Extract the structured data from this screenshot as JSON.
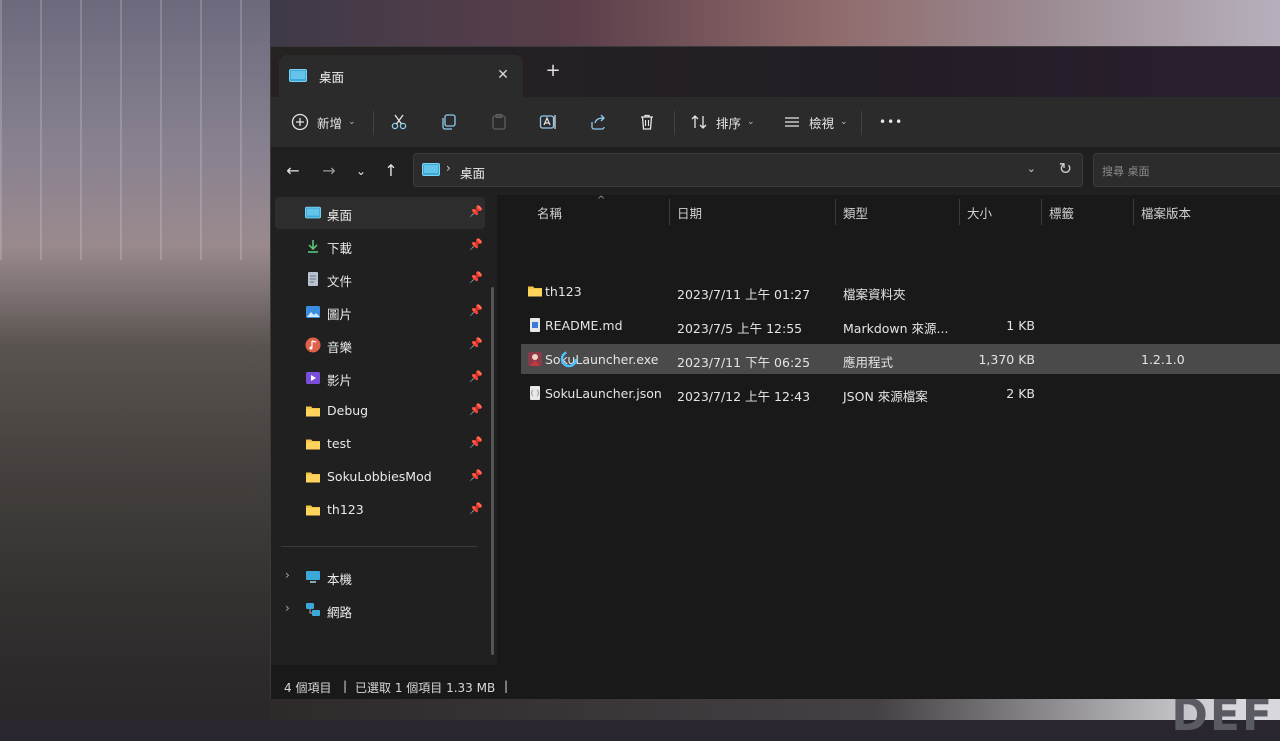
{
  "window": {
    "tab_title": "桌面",
    "tab_close": "✕",
    "new_tab": "+"
  },
  "toolbar": {
    "new_label": "新增",
    "sort_label": "排序",
    "view_label": "檢視",
    "more": "•••",
    "icons": [
      "plus-circle-icon",
      "scissors-icon",
      "copy-icon",
      "paste-icon",
      "rename-icon",
      "share-icon",
      "trash-icon",
      "sort-icon",
      "view-icon",
      "more-icon"
    ]
  },
  "nav": {
    "breadcrumb": "桌面",
    "search_placeholder": "搜尋 桌面"
  },
  "sidebar": {
    "items": [
      {
        "label": "桌面",
        "icon": "desktop-icon",
        "pinned": true
      },
      {
        "label": "下載",
        "icon": "download-icon",
        "pinned": true
      },
      {
        "label": "文件",
        "icon": "document-icon",
        "pinned": true
      },
      {
        "label": "圖片",
        "icon": "pictures-icon",
        "pinned": true
      },
      {
        "label": "音樂",
        "icon": "music-icon",
        "pinned": true
      },
      {
        "label": "影片",
        "icon": "video-icon",
        "pinned": true
      },
      {
        "label": "Debug",
        "icon": "folder-icon",
        "pinned": true
      },
      {
        "label": "test",
        "icon": "folder-icon",
        "pinned": true
      },
      {
        "label": "SokuLobbiesMod",
        "icon": "folder-icon",
        "pinned": true
      },
      {
        "label": "th123",
        "icon": "folder-icon",
        "pinned": true
      }
    ],
    "bottom": [
      {
        "label": "本機",
        "icon": "computer-icon"
      },
      {
        "label": "網路",
        "icon": "network-icon"
      }
    ]
  },
  "columns": {
    "name": "名稱",
    "date": "日期",
    "type": "類型",
    "size": "大小",
    "tags": "標籤",
    "version": "檔案版本"
  },
  "files": [
    {
      "name": "th123",
      "date": "2023/7/11 上午 01:27",
      "type": "檔案資料夾",
      "size": "",
      "version": "",
      "icon": "folder-icon"
    },
    {
      "name": "README.md",
      "date": "2023/7/5 上午 12:55",
      "type": "Markdown 來源...",
      "size": "1 KB",
      "version": "",
      "icon": "markdown-file-icon"
    },
    {
      "name": "SokuLauncher.exe",
      "date": "2023/7/11 下午 06:25",
      "type": "應用程式",
      "size": "1,370 KB",
      "version": "1.2.1.0",
      "icon": "app-icon"
    },
    {
      "name": "SokuLauncher.json",
      "date": "2023/7/12 上午 12:43",
      "type": "JSON 來源檔案",
      "size": "2 KB",
      "version": "",
      "icon": "json-file-icon"
    }
  ],
  "status": {
    "count": "4 個項目",
    "sep1": "|",
    "selected": "已選取 1 個項目 1.33 MB",
    "sep2": "|"
  },
  "colors": {
    "accent": "#4cc2ff",
    "folder": "#f6c445",
    "selected_row": "#4a4a4a"
  },
  "wallpaper_text": "DEF"
}
